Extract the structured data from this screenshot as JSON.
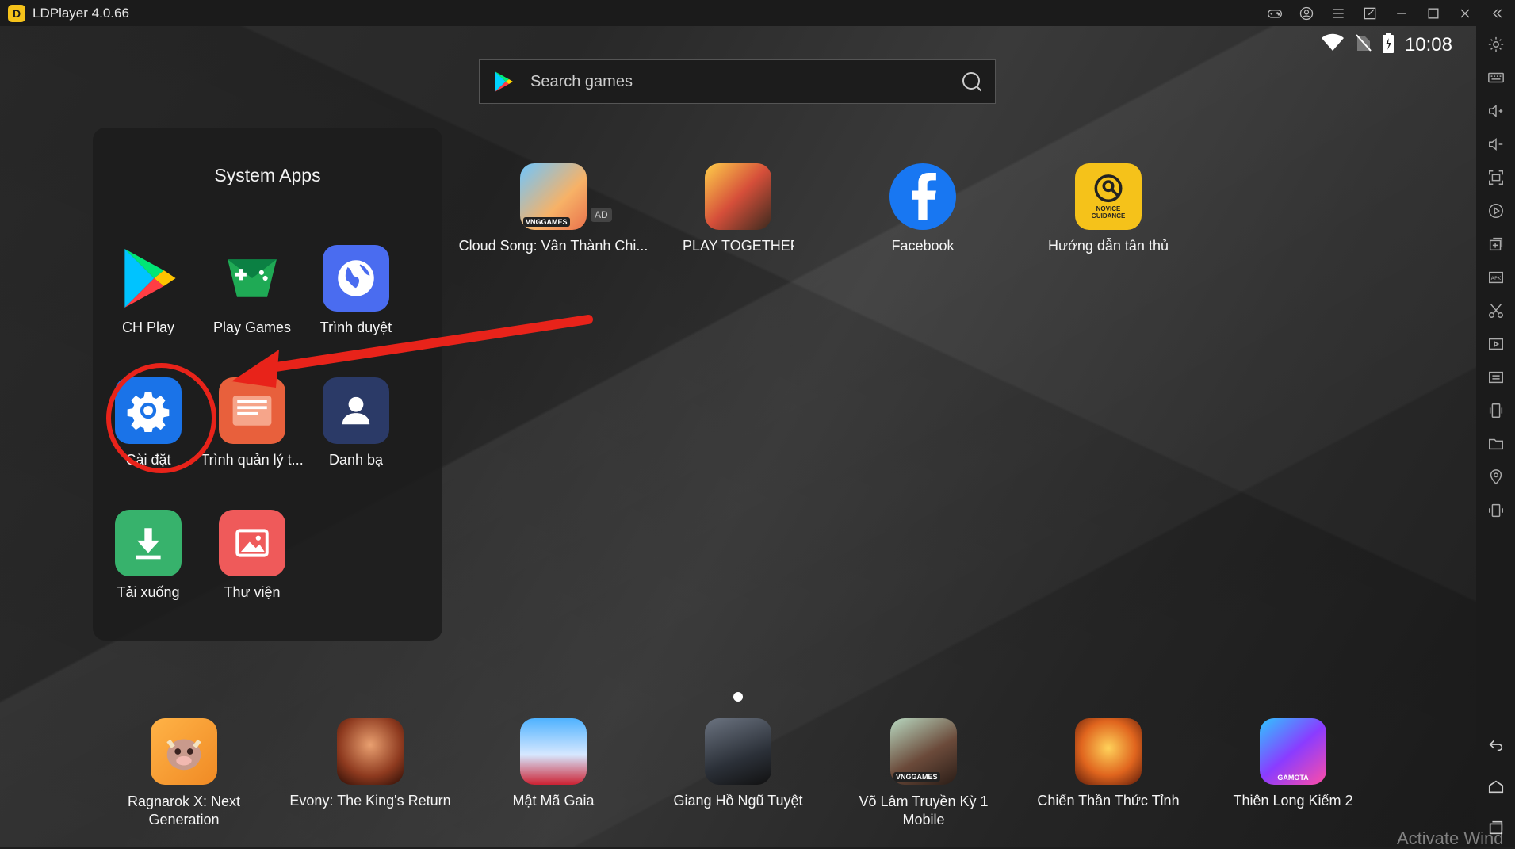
{
  "window": {
    "title": "LDPlayer 4.0.66",
    "logo_glyph": "D"
  },
  "status": {
    "time": "10:08"
  },
  "search": {
    "placeholder": "Search games"
  },
  "folder": {
    "title": "System Apps",
    "apps": [
      {
        "label": "CH Play",
        "icon": "play-store-icon"
      },
      {
        "label": "Play Games",
        "icon": "play-games-icon"
      },
      {
        "label": "Trình duyệt",
        "icon": "browser-icon"
      },
      {
        "label": "Cài đặt",
        "icon": "settings-gear-icon"
      },
      {
        "label": "Trình quản lý t...",
        "icon": "file-manager-icon"
      },
      {
        "label": "Danh bạ",
        "icon": "contacts-icon"
      },
      {
        "label": "Tải xuống",
        "icon": "download-icon"
      },
      {
        "label": "Thư viện",
        "icon": "gallery-icon"
      }
    ]
  },
  "home_apps": [
    {
      "label": "Cloud Song: Vân Thành Chi...",
      "badge": "AD",
      "icon": "cloud-song-icon",
      "icon_text": "VNGGAMES"
    },
    {
      "label": "PLAY TOGETHER",
      "icon": "play-together-icon"
    },
    {
      "label": "Facebook",
      "icon": "facebook-icon"
    },
    {
      "label": "Hướng dẫn tân thủ",
      "icon": "novice-guidance-icon",
      "icon_text": "NOVICE GUIDANCE"
    }
  ],
  "dock_apps": [
    {
      "label": "Ragnarok X: Next Generation",
      "icon": "ragnarok-icon"
    },
    {
      "label": "Evony: The King's Return",
      "icon": "evony-icon"
    },
    {
      "label": "Mật Mã Gaia",
      "icon": "gaia-icon"
    },
    {
      "label": "Giang Hồ Ngũ Tuyệt",
      "icon": "giang-ho-icon"
    },
    {
      "label": "Võ Lâm Truyền Kỳ 1 Mobile",
      "icon": "vo-lam-icon",
      "icon_text": "VNGGAMES"
    },
    {
      "label": "Chiến Thần Thức Tỉnh",
      "icon": "chien-than-icon"
    },
    {
      "label": "Thiên Long Kiếm 2",
      "icon": "thien-long-icon",
      "icon_text": "GAMOTA"
    }
  ],
  "watermark": "Activate Wind",
  "colors": {
    "annotation": "#e8231a",
    "accent": "#f5c21a",
    "settings_blue": "#1a73e8"
  }
}
